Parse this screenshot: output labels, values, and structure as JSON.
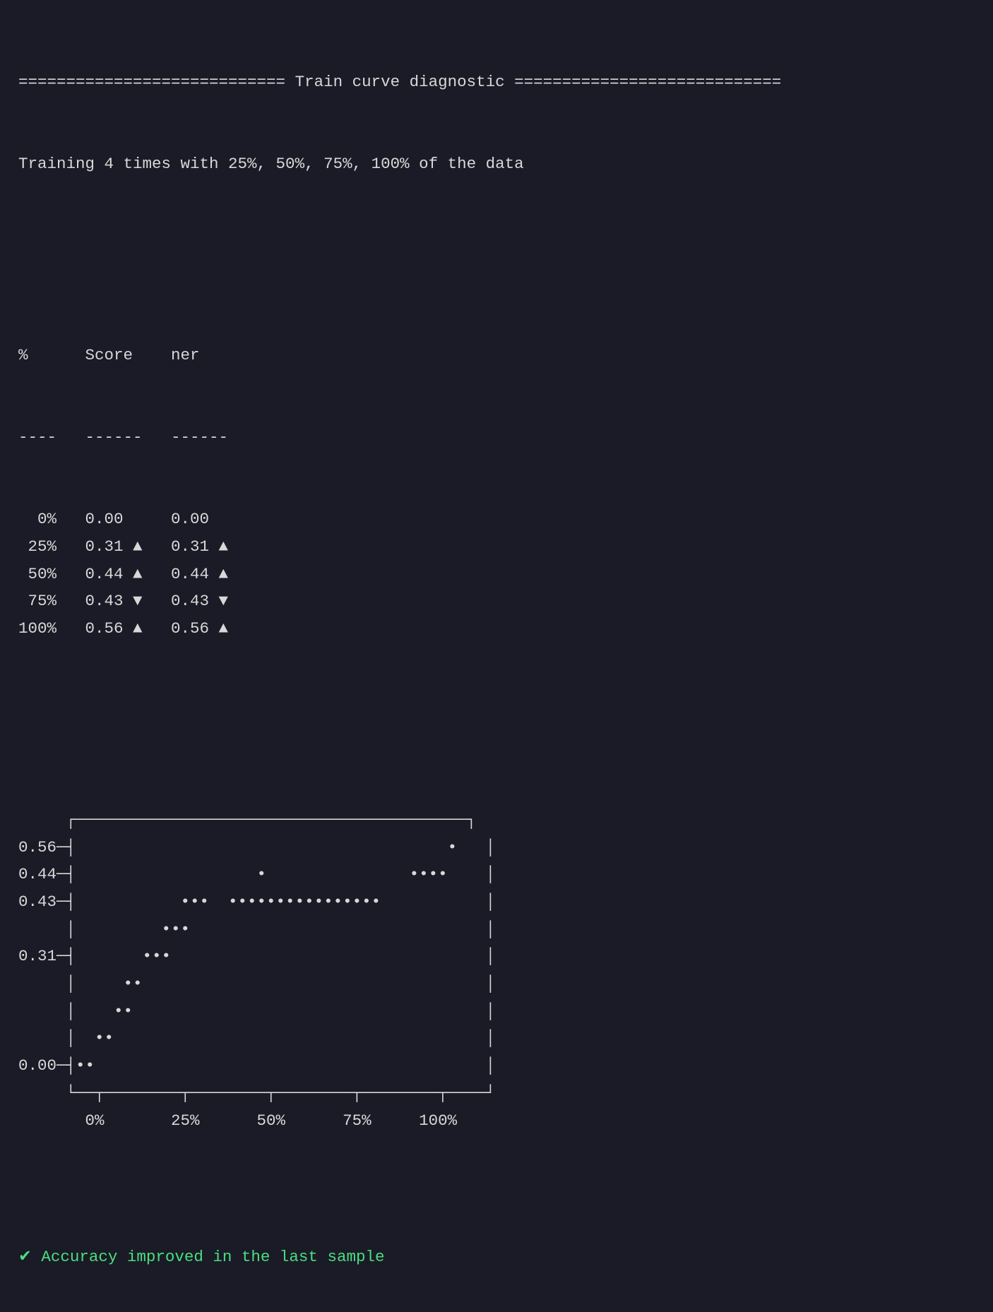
{
  "header": {
    "title": "Train curve diagnostic",
    "title_rule": "=",
    "title_left": "============================",
    "title_right": "============================",
    "subtitle": "Training 4 times with 25%, 50%, 75%, 100% of the data"
  },
  "table": {
    "headers": [
      "%",
      "Score",
      "ner"
    ],
    "divider": [
      "----",
      "------",
      "------"
    ],
    "rows": [
      {
        "pct": "0%",
        "score": "0.00",
        "score_dir": "",
        "ner": "0.00",
        "ner_dir": ""
      },
      {
        "pct": "25%",
        "score": "0.31",
        "score_dir": "▲",
        "ner": "0.31",
        "ner_dir": "▲"
      },
      {
        "pct": "50%",
        "score": "0.44",
        "score_dir": "▲",
        "ner": "0.44",
        "ner_dir": "▲"
      },
      {
        "pct": "75%",
        "score": "0.43",
        "score_dir": "▼",
        "ner": "0.43",
        "ner_dir": "▼"
      },
      {
        "pct": "100%",
        "score": "0.56",
        "score_dir": "▲",
        "ner": "0.56",
        "ner_dir": "▲"
      }
    ]
  },
  "chart_data": {
    "type": "line",
    "title": "",
    "xlabel": "",
    "ylabel": "",
    "categories": [
      "0%",
      "25%",
      "50%",
      "75%",
      "100%"
    ],
    "series": [
      {
        "name": "Score",
        "values": [
          0.0,
          0.31,
          0.44,
          0.43,
          0.56
        ]
      }
    ],
    "y_ticks": [
      0.0,
      0.31,
      0.43,
      0.44,
      0.56
    ],
    "x_ticks": [
      "0%",
      "25%",
      "50%",
      "75%",
      "100%"
    ],
    "xlim": [
      0,
      100
    ],
    "ylim": [
      0.0,
      0.56
    ]
  },
  "ascii_chart": {
    "lines": [
      "     ┌─────────────────────────────────────────┐",
      "0.56─┤                                       •   │",
      "0.44─┤                   •               ••••    │",
      "0.43─┤           •••  ••••••••••••••••           │",
      "     │         •••                               │",
      "0.31─┤       •••                                 │",
      "     │     ••                                    │",
      "     │    ••                                     │",
      "     │  ••                                       │",
      "0.00─┤••                                         │",
      "     └──┬────────┬────────┬────────┬────────┬────┘",
      "       0%       25%      50%      75%     100%"
    ]
  },
  "status": {
    "check": "✔",
    "text": "Accuracy improved in the last sample"
  }
}
